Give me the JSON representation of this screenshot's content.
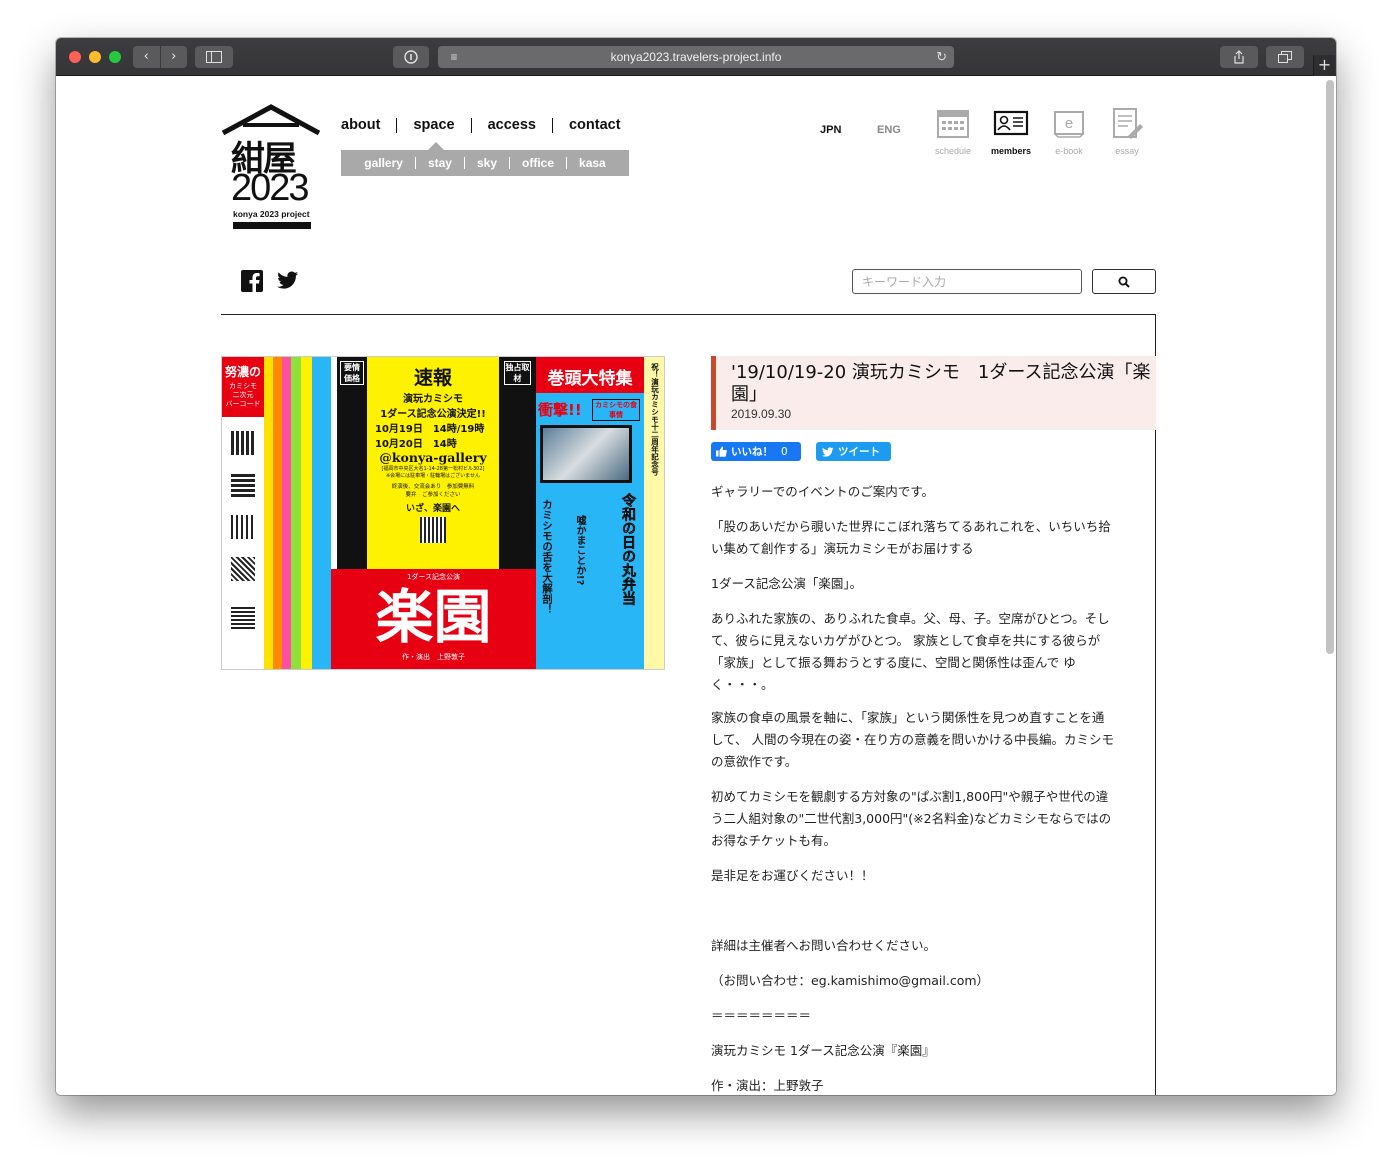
{
  "browser": {
    "url": "konya2023.travelers-project.info"
  },
  "site": {
    "logo_kanji": "紺屋",
    "logo_year": "2023",
    "logo_sub": "konya 2023 project",
    "nav": [
      "about",
      "space",
      "access",
      "contact"
    ],
    "subnav": [
      "gallery",
      "stay",
      "sky",
      "office",
      "kasa"
    ],
    "lang_jpn": "JPN",
    "lang_eng": "ENG",
    "icons": [
      {
        "label": "schedule",
        "icon": "calendar-icon"
      },
      {
        "label": "members",
        "icon": "id-card-icon"
      },
      {
        "label": "e-book",
        "icon": "ebook-icon"
      },
      {
        "label": "essay",
        "icon": "essay-icon"
      }
    ],
    "search_placeholder": "キーワード入力"
  },
  "poster": {
    "left_header": "努濃の",
    "left_sub": "カミシモ\n二次元\nバーコード",
    "sokuho": "速報",
    "sokuho_group": "演玩カミシモ",
    "sokuho_main": "1ダース記念公演決定!!",
    "dates": [
      "10月19日　14時/19時",
      "10月20日　14時"
    ],
    "gallery": "@konya-gallery",
    "address": "[福岡市中央区大名1-14-28第一松村ビル302]",
    "parking": "※会場には駐車場・駐輪場はございません",
    "notes": "終演後、交流会あり　参加費無料\n要弁　ご参加ください",
    "iza": "いざ、楽園へ",
    "tokushu": "巻頭大特集",
    "shogeki": "衝撃!!",
    "shokuji": "カミシモの食事情",
    "kinen": "1ダース記念公演",
    "rakuen": "楽園",
    "author_credit": "作・演出　上野敦子",
    "kanren_tag": "要情価格",
    "dokusen_tag": "独占取材",
    "reiwa": "令和の日の丸弁当",
    "kamishimo_shita": "カミシモの舌を大解剖！",
    "uso": "嘘かまことか!?",
    "iwai": "祝！演玩カミシモ十二周年記念号"
  },
  "article": {
    "title": "'19/10/19-20 演玩カミシモ　1ダース記念公演「楽園」",
    "date": "2019.09.30",
    "like_label": "いいね！",
    "like_count": "0",
    "tweet_label": "ツイート",
    "paragraphs": [
      "ギャラリーでのイベントのご案内です。",
      "「股のあいだから覗いた世界にこぼれ落ちてるあれこれを、いちいち拾い集めて創作する」演玩カミシモがお届けする",
      "1ダース記念公演「楽園」。",
      "ありふれた家族の、ありふれた食卓。父、母、子。空席がひとつ。そして、彼らに見えないカゲがひとつ。 家族として食卓を共にする彼らが「家族」として振る舞おうとする度に、空間と関係性は歪んで ゆく・・・。",
      "家族の食卓の風景を軸に、「家族」という関係性を見つめ直すことを通して、 人間の今現在の姿・在り方の意義を問いかける中長編。カミシモの意欲作です。",
      "初めてカミシモを観劇する方対象の\"ぱぶ割1,800円\"や親子や世代の違う二人組対象の\"二世代割3,000円\"(※2名料金)などカミシモならではのお得なチケットも有。",
      "是非足をお運びください！！",
      "詳細は主催者へお問い合わせください。",
      "（お問い合わせ：eg.kamishimo@gmail.com）",
      "＝＝＝＝＝＝＝＝",
      "演玩カミシモ 1ダース記念公演『楽園』",
      "作・演出：上野敦子"
    ]
  }
}
